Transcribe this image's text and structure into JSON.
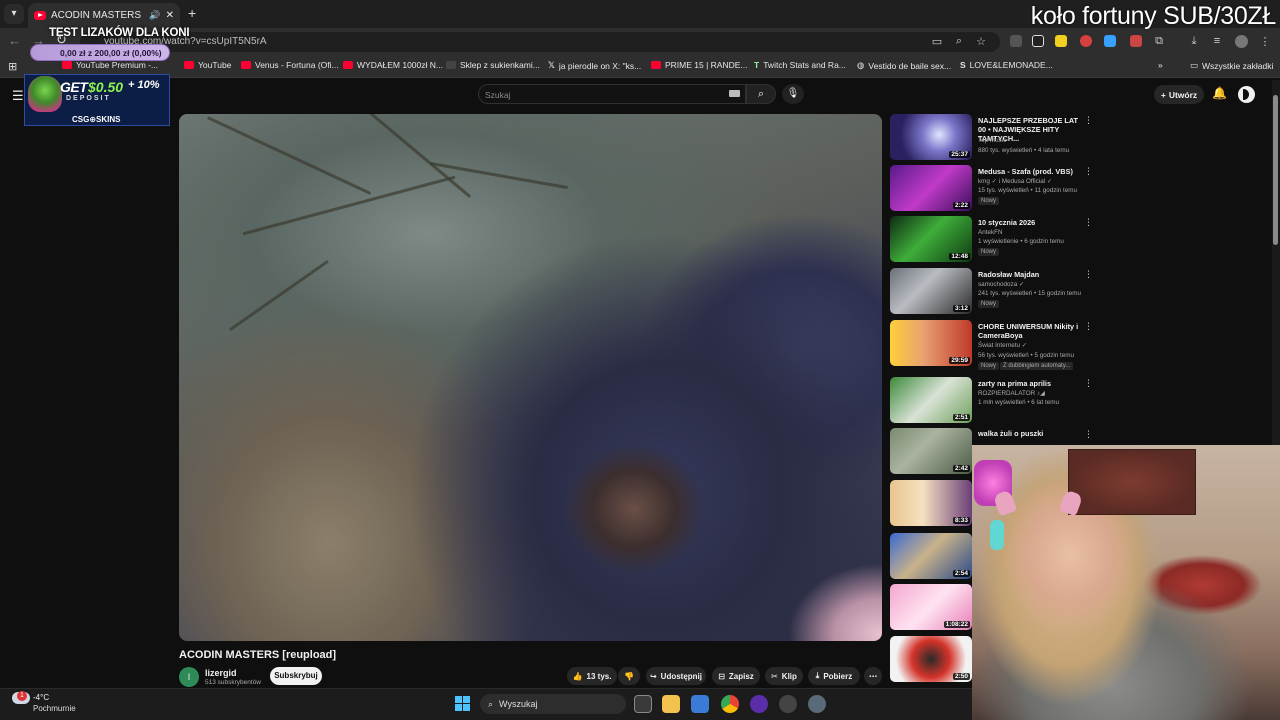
{
  "browser": {
    "tab_title": "ACODIN MASTERS [reupload]",
    "url": "youtube.com/watch?v=csUpIT5N5rA",
    "bookmarks": [
      {
        "label": "YouTube Premium -..."
      },
      {
        "label": "YouTube"
      },
      {
        "label": "Venus - Fortuna (Ofi..."
      },
      {
        "label": "WYDAŁEM 1000zł N..."
      },
      {
        "label": "Sklep z sukienkami..."
      },
      {
        "label": "ja pierodle on X: \"ks..."
      },
      {
        "label": "PRIME 15 | RANDE..."
      },
      {
        "label": "Twitch Stats and Ra..."
      },
      {
        "label": "Vestido de baile sex..."
      },
      {
        "label": "LOVE&LEMONADE..."
      }
    ],
    "all_bookmarks": "Wszystkie zakładki"
  },
  "overlay": {
    "stream_title": "koło fortuny SUB/30ZŁ",
    "goal_title": "TEST LIZAKÓW DLA KONI",
    "goal_progress": "0,00 zł z 200,00 zł (0,00%)",
    "goal_fraction": 0.0,
    "ad_get": "GET",
    "ad_money": "$0.50",
    "ad_plus": "+ 10%",
    "ad_deposit": "DEPOSIT",
    "ad_brand": "CSG⊕SKINS"
  },
  "youtube": {
    "search_placeholder": "Szukaj",
    "create_label": "Utwórz",
    "video_title": "ACODIN MASTERS [reupload]",
    "channel_name": "lizergid",
    "channel_initial": "l",
    "subscribers": "513 subskrybentów",
    "subscribe_label": "Subskrybuj",
    "actions": {
      "likes": "13 tys.",
      "share": "Udostępnij",
      "save": "Zapisz",
      "clip": "Klip",
      "download": "Pobierz"
    }
  },
  "recommendations": [
    {
      "title": "NAJLEPSZE PRZEBOJE LAT 00 • NAJWIĘKSZE HITY TAMTYCH...",
      "channel": "Top Music",
      "meta": "880 tys. wyświetleń • 4 lata temu",
      "duration": "25:37",
      "badge": ""
    },
    {
      "title": "Medusa - Szafa (prod. VBS)",
      "channel": "kmg ✓ i Medusa Official ✓",
      "meta": "15 tys. wyświetleń • 11 godzin temu",
      "duration": "2:22",
      "badge": "Nowy"
    },
    {
      "title": "10 stycznia 2026",
      "channel": "AntekFN",
      "meta": "1 wyświetlenie • 6 godzin temu",
      "duration": "12:48",
      "badge": "Nowy"
    },
    {
      "title": "Radosław Majdan",
      "channel": "samochodoza ✓",
      "meta": "241 tys. wyświetleń • 15 godzin temu",
      "duration": "3:12",
      "badge": "Nowy"
    },
    {
      "title": "CHORE UNIWERSUM Nikity i CameraBoya",
      "channel": "Świat Internetu ✓",
      "meta": "56 tys. wyświetleń • 5 godzin temu",
      "duration": "29:59",
      "badge": "Nowy",
      "extra": "Z dubbingiem automaty..."
    },
    {
      "title": "zarty na prima aprilis",
      "channel": "ROZPIERDALATOR ♪◢",
      "meta": "1 mln wyświetleń • 6 lat temu",
      "duration": "2:51",
      "badge": ""
    },
    {
      "title": "walka żuli o puszki",
      "channel": "",
      "meta": "",
      "duration": "2:42",
      "badge": ""
    },
    {
      "title": "",
      "channel": "",
      "meta": "",
      "duration": "8:33",
      "badge": ""
    },
    {
      "title": "",
      "channel": "",
      "meta": "",
      "duration": "2:54",
      "badge": ""
    },
    {
      "title": "",
      "channel": "",
      "meta": "",
      "duration": "1:08:22",
      "badge": ""
    },
    {
      "title": "",
      "channel": "",
      "meta": "",
      "duration": "2:50",
      "badge": ""
    }
  ],
  "taskbar": {
    "temperature": "-4°C",
    "condition": "Pochmurnie",
    "weather_badge": "1",
    "search_label": "Wyszukaj"
  }
}
